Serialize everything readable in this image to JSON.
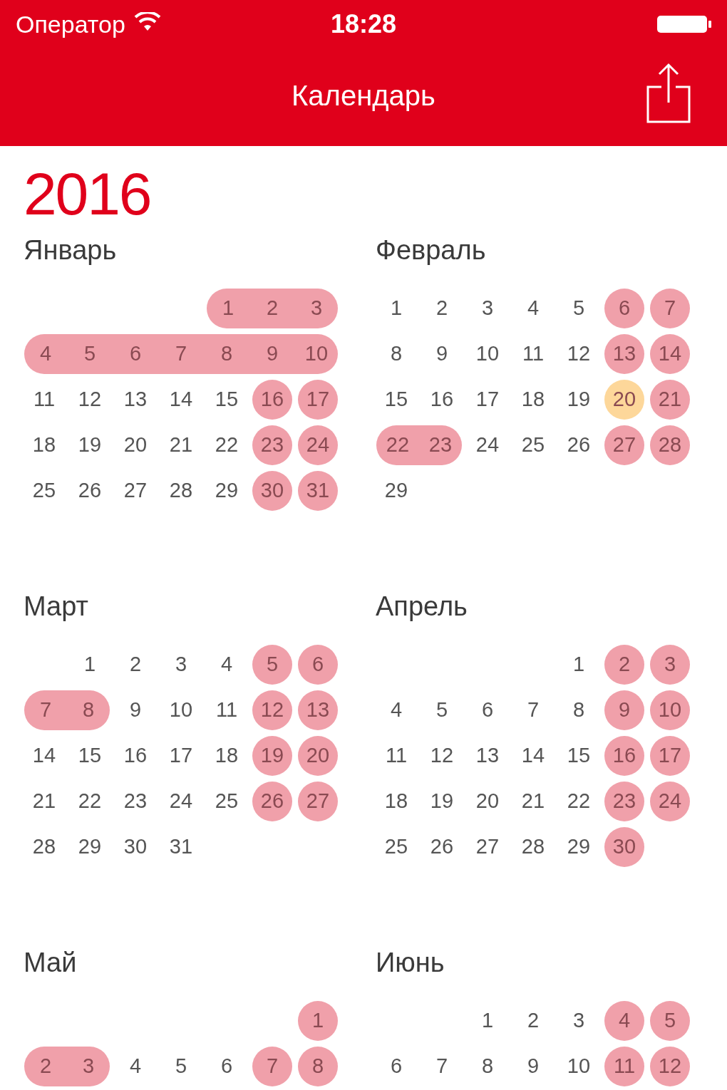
{
  "status_bar": {
    "carrier": "Оператор",
    "time": "18:28"
  },
  "nav_bar": {
    "title": "Календарь"
  },
  "year": "2016",
  "months": [
    {
      "name": "Январь",
      "weeks": [
        [
          {
            "day": "1",
            "kind": "holiday"
          },
          {
            "day": "2",
            "kind": "holiday"
          },
          {
            "day": "3",
            "kind": "holiday"
          }
        ],
        [
          {
            "day": "4",
            "kind": "holiday"
          },
          {
            "day": "5",
            "kind": "holiday"
          },
          {
            "day": "6",
            "kind": "holiday"
          },
          {
            "day": "7",
            "kind": "holiday"
          },
          {
            "day": "8",
            "kind": "holiday"
          },
          {
            "day": "9",
            "kind": "holiday"
          },
          {
            "day": "10",
            "kind": "holiday"
          }
        ],
        [
          {
            "day": "11",
            "kind": "workday"
          },
          {
            "day": "12",
            "kind": "workday"
          },
          {
            "day": "13",
            "kind": "workday"
          },
          {
            "day": "14",
            "kind": "workday"
          },
          {
            "day": "15",
            "kind": "workday"
          },
          {
            "day": "16",
            "kind": "weekend"
          },
          {
            "day": "17",
            "kind": "weekend"
          }
        ],
        [
          {
            "day": "18",
            "kind": "workday"
          },
          {
            "day": "19",
            "kind": "workday"
          },
          {
            "day": "20",
            "kind": "workday"
          },
          {
            "day": "21",
            "kind": "workday"
          },
          {
            "day": "22",
            "kind": "workday"
          },
          {
            "day": "23",
            "kind": "weekend"
          },
          {
            "day": "24",
            "kind": "weekend"
          }
        ],
        [
          {
            "day": "25",
            "kind": "workday"
          },
          {
            "day": "26",
            "kind": "workday"
          },
          {
            "day": "27",
            "kind": "workday"
          },
          {
            "day": "28",
            "kind": "workday"
          },
          {
            "day": "29",
            "kind": "workday"
          },
          {
            "day": "30",
            "kind": "weekend"
          },
          {
            "day": "31",
            "kind": "weekend"
          }
        ]
      ]
    },
    {
      "name": "Февраль",
      "weeks": [
        [
          {
            "day": "1",
            "kind": "workday"
          },
          {
            "day": "2",
            "kind": "workday"
          },
          {
            "day": "3",
            "kind": "workday"
          },
          {
            "day": "4",
            "kind": "workday"
          },
          {
            "day": "5",
            "kind": "workday"
          },
          {
            "day": "6",
            "kind": "weekend"
          },
          {
            "day": "7",
            "kind": "weekend"
          }
        ],
        [
          {
            "day": "8",
            "kind": "workday"
          },
          {
            "day": "9",
            "kind": "workday"
          },
          {
            "day": "10",
            "kind": "workday"
          },
          {
            "day": "11",
            "kind": "workday"
          },
          {
            "day": "12",
            "kind": "workday"
          },
          {
            "day": "13",
            "kind": "weekend"
          },
          {
            "day": "14",
            "kind": "weekend"
          }
        ],
        [
          {
            "day": "15",
            "kind": "workday"
          },
          {
            "day": "16",
            "kind": "workday"
          },
          {
            "day": "17",
            "kind": "workday"
          },
          {
            "day": "18",
            "kind": "workday"
          },
          {
            "day": "19",
            "kind": "workday"
          },
          {
            "day": "20",
            "kind": "today"
          },
          {
            "day": "21",
            "kind": "weekend"
          }
        ],
        [
          {
            "day": "22",
            "kind": "holiday"
          },
          {
            "day": "23",
            "kind": "holiday"
          },
          {
            "day": "24",
            "kind": "workday"
          },
          {
            "day": "25",
            "kind": "workday"
          },
          {
            "day": "26",
            "kind": "workday"
          },
          {
            "day": "27",
            "kind": "weekend"
          },
          {
            "day": "28",
            "kind": "weekend"
          }
        ],
        [
          {
            "day": "29",
            "kind": "workday"
          }
        ]
      ]
    },
    {
      "name": "Март",
      "weeks": [
        [
          {
            "day": "1",
            "kind": "workday"
          },
          {
            "day": "2",
            "kind": "workday"
          },
          {
            "day": "3",
            "kind": "workday"
          },
          {
            "day": "4",
            "kind": "workday"
          },
          {
            "day": "5",
            "kind": "weekend"
          },
          {
            "day": "6",
            "kind": "weekend"
          }
        ],
        [
          {
            "day": "7",
            "kind": "holiday"
          },
          {
            "day": "8",
            "kind": "holiday"
          },
          {
            "day": "9",
            "kind": "workday"
          },
          {
            "day": "10",
            "kind": "workday"
          },
          {
            "day": "11",
            "kind": "workday"
          },
          {
            "day": "12",
            "kind": "weekend"
          },
          {
            "day": "13",
            "kind": "weekend"
          }
        ],
        [
          {
            "day": "14",
            "kind": "workday"
          },
          {
            "day": "15",
            "kind": "workday"
          },
          {
            "day": "16",
            "kind": "workday"
          },
          {
            "day": "17",
            "kind": "workday"
          },
          {
            "day": "18",
            "kind": "workday"
          },
          {
            "day": "19",
            "kind": "weekend"
          },
          {
            "day": "20",
            "kind": "weekend"
          }
        ],
        [
          {
            "day": "21",
            "kind": "workday"
          },
          {
            "day": "22",
            "kind": "workday"
          },
          {
            "day": "23",
            "kind": "workday"
          },
          {
            "day": "24",
            "kind": "workday"
          },
          {
            "day": "25",
            "kind": "workday"
          },
          {
            "day": "26",
            "kind": "weekend"
          },
          {
            "day": "27",
            "kind": "weekend"
          }
        ],
        [
          {
            "day": "28",
            "kind": "workday"
          },
          {
            "day": "29",
            "kind": "workday"
          },
          {
            "day": "30",
            "kind": "workday"
          },
          {
            "day": "31",
            "kind": "workday"
          }
        ]
      ]
    },
    {
      "name": "Апрель",
      "weeks": [
        [
          {
            "day": "1",
            "kind": "workday"
          },
          {
            "day": "2",
            "kind": "weekend"
          },
          {
            "day": "3",
            "kind": "weekend"
          }
        ],
        [
          {
            "day": "4",
            "kind": "workday"
          },
          {
            "day": "5",
            "kind": "workday"
          },
          {
            "day": "6",
            "kind": "workday"
          },
          {
            "day": "7",
            "kind": "workday"
          },
          {
            "day": "8",
            "kind": "workday"
          },
          {
            "day": "9",
            "kind": "weekend"
          },
          {
            "day": "10",
            "kind": "weekend"
          }
        ],
        [
          {
            "day": "11",
            "kind": "workday"
          },
          {
            "day": "12",
            "kind": "workday"
          },
          {
            "day": "13",
            "kind": "workday"
          },
          {
            "day": "14",
            "kind": "workday"
          },
          {
            "day": "15",
            "kind": "workday"
          },
          {
            "day": "16",
            "kind": "weekend"
          },
          {
            "day": "17",
            "kind": "weekend"
          }
        ],
        [
          {
            "day": "18",
            "kind": "workday"
          },
          {
            "day": "19",
            "kind": "workday"
          },
          {
            "day": "20",
            "kind": "workday"
          },
          {
            "day": "21",
            "kind": "workday"
          },
          {
            "day": "22",
            "kind": "workday"
          },
          {
            "day": "23",
            "kind": "weekend"
          },
          {
            "day": "24",
            "kind": "weekend"
          }
        ],
        [
          {
            "day": "25",
            "kind": "workday"
          },
          {
            "day": "26",
            "kind": "workday"
          },
          {
            "day": "27",
            "kind": "workday"
          },
          {
            "day": "28",
            "kind": "workday"
          },
          {
            "day": "29",
            "kind": "workday"
          },
          {
            "day": "30",
            "kind": "weekend"
          }
        ]
      ]
    },
    {
      "name": "Май",
      "weeks": [
        [
          {
            "day": "1",
            "kind": "weekend"
          }
        ],
        [
          {
            "day": "2",
            "kind": "holiday"
          },
          {
            "day": "3",
            "kind": "holiday"
          },
          {
            "day": "4",
            "kind": "workday"
          },
          {
            "day": "5",
            "kind": "workday"
          },
          {
            "day": "6",
            "kind": "workday"
          },
          {
            "day": "7",
            "kind": "weekend"
          },
          {
            "day": "8",
            "kind": "weekend"
          }
        ]
      ]
    },
    {
      "name": "Июнь",
      "weeks": [
        [
          {
            "day": "1",
            "kind": "workday"
          },
          {
            "day": "2",
            "kind": "workday"
          },
          {
            "day": "3",
            "kind": "workday"
          },
          {
            "day": "4",
            "kind": "weekend"
          },
          {
            "day": "5",
            "kind": "weekend"
          }
        ],
        [
          {
            "day": "6",
            "kind": "workday"
          },
          {
            "day": "7",
            "kind": "workday"
          },
          {
            "day": "8",
            "kind": "workday"
          },
          {
            "day": "9",
            "kind": "workday"
          },
          {
            "day": "10",
            "kind": "workday"
          },
          {
            "day": "11",
            "kind": "weekend"
          },
          {
            "day": "12",
            "kind": "weekend"
          }
        ]
      ]
    }
  ]
}
